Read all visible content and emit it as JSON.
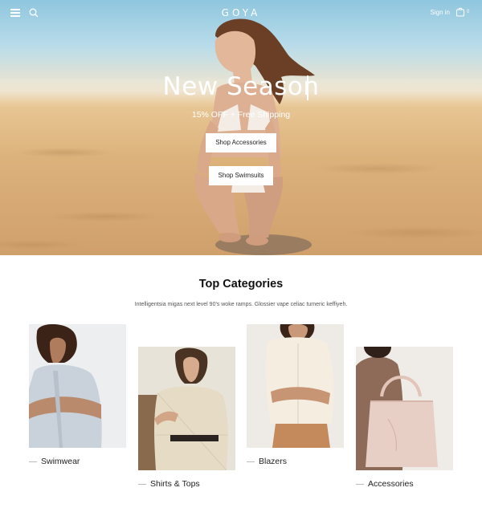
{
  "header": {
    "logo": "GOYA",
    "sign_in": "Sign in",
    "cart_count": "0"
  },
  "hero": {
    "title": "New Season",
    "subtitle": "15% OFF + Free Shipping",
    "buttons": [
      "Shop Accessories",
      "Shop Swimsuits"
    ]
  },
  "categories": {
    "title": "Top Categories",
    "description": "Intelligentsia migas next level 90's woke ramps. Glossier vape celiac tumeric keffiyeh.",
    "items": [
      {
        "label": "Swimwear"
      },
      {
        "label": "Shirts & Tops"
      },
      {
        "label": "Blazers"
      },
      {
        "label": "Accessories"
      }
    ]
  },
  "colors": {
    "accent_text": "#222222",
    "background": "#ffffff"
  },
  "icons": [
    "menu-icon",
    "search-icon",
    "cart-icon"
  ]
}
